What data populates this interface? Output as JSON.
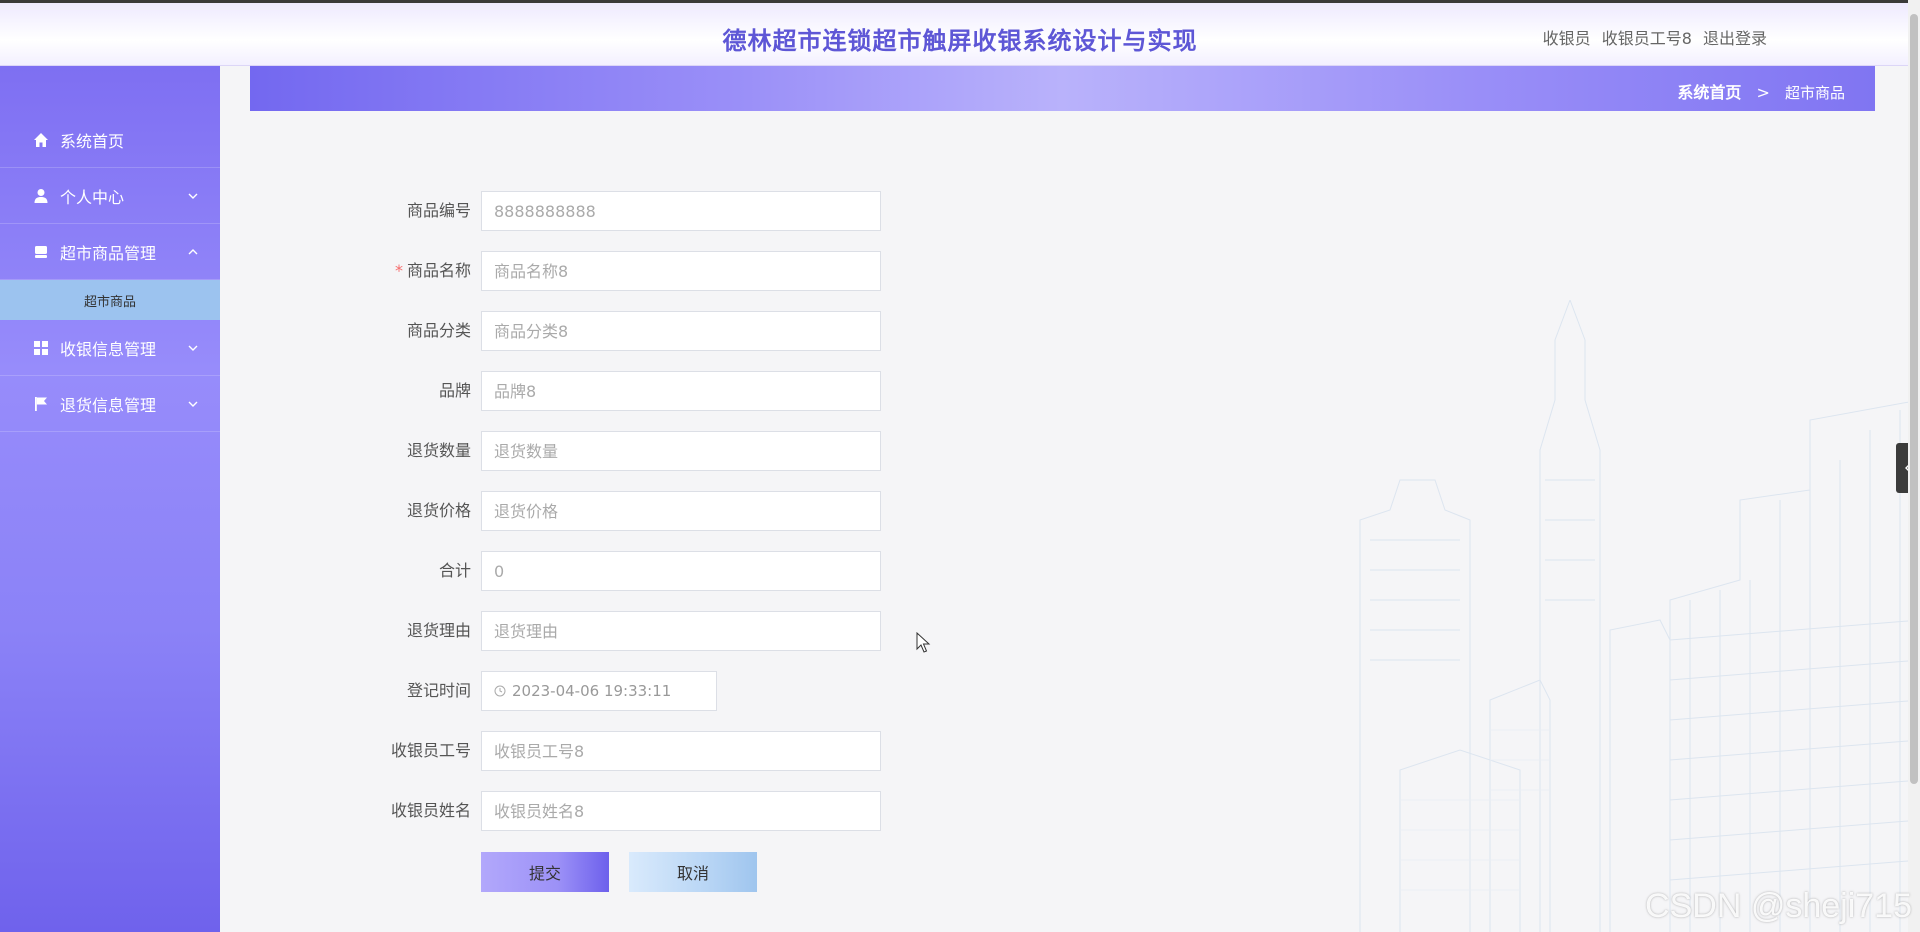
{
  "header": {
    "title": "德林超市连锁超市触屏收银系统设计与实现",
    "role": "收银员",
    "username": "收银员工号8",
    "logout_label": "退出登录"
  },
  "sidebar": {
    "items": [
      {
        "label": "系统首页",
        "icon": "home-icon"
      },
      {
        "label": "个人中心",
        "icon": "user-icon"
      },
      {
        "label": "超市商品管理",
        "icon": "product-icon",
        "expanded": true,
        "children": [
          {
            "label": "超市商品"
          }
        ]
      },
      {
        "label": "收银信息管理",
        "icon": "grid-icon"
      },
      {
        "label": "退货信息管理",
        "icon": "flag-icon"
      }
    ]
  },
  "breadcrumb": {
    "home": "系统首页",
    "separator": ">",
    "current": "超市商品"
  },
  "form": {
    "fields": [
      {
        "label": "商品编号",
        "placeholder": "8888888888",
        "required": false
      },
      {
        "label": "商品名称",
        "placeholder": "商品名称8",
        "required": true
      },
      {
        "label": "商品分类",
        "placeholder": "商品分类8",
        "required": false
      },
      {
        "label": "品牌",
        "placeholder": "品牌8",
        "required": false
      },
      {
        "label": "退货数量",
        "placeholder": "退货数量",
        "required": false
      },
      {
        "label": "退货价格",
        "placeholder": "退货价格",
        "required": false
      },
      {
        "label": "合计",
        "placeholder": "0",
        "required": false
      },
      {
        "label": "退货理由",
        "placeholder": "退货理由",
        "required": false
      },
      {
        "label": "登记时间",
        "value": "2023-04-06 19:33:11",
        "type": "datetime"
      },
      {
        "label": "收银员工号",
        "placeholder": "收银员工号8",
        "required": false
      },
      {
        "label": "收银员姓名",
        "placeholder": "收银员姓名8",
        "required": false
      }
    ],
    "required_mark": "*",
    "submit_label": "提交",
    "cancel_label": "取消"
  },
  "watermark": "CSDN @sheji715",
  "colors": {
    "accent": "#5e57d6",
    "sidebar_top": "#7e6ff2",
    "submenu_bg": "#9cc3ef",
    "required": "#f56c6c"
  }
}
